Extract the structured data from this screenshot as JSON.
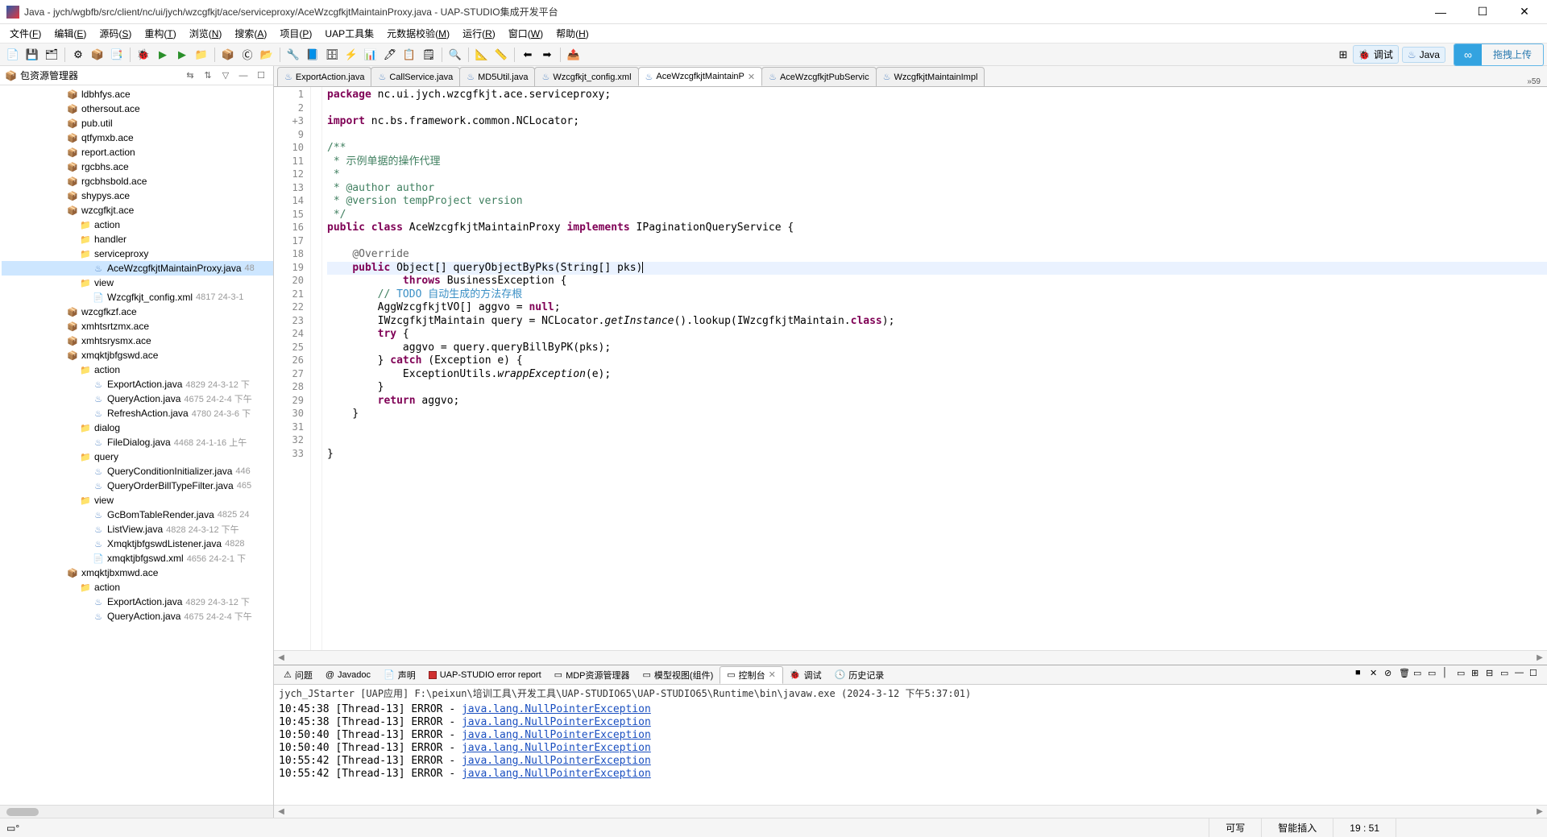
{
  "window": {
    "title": "Java - jych/wgbfb/src/client/nc/ui/jych/wzcgfkjt/ace/serviceproxy/AceWzcgfkjtMaintainProxy.java - UAP-STUDIO集成开发平台"
  },
  "menu": {
    "items": [
      {
        "label": "文件",
        "mn": "F"
      },
      {
        "label": "编辑",
        "mn": "E"
      },
      {
        "label": "源码",
        "mn": "S"
      },
      {
        "label": "重构",
        "mn": "T"
      },
      {
        "label": "浏览",
        "mn": "N"
      },
      {
        "label": "搜索",
        "mn": "A"
      },
      {
        "label": "项目",
        "mn": "P"
      },
      {
        "label": "UAP工具集",
        "mn": ""
      },
      {
        "label": "元数据校验",
        "mn": "M"
      },
      {
        "label": "运行",
        "mn": "R"
      },
      {
        "label": "窗口",
        "mn": "W"
      },
      {
        "label": "帮助",
        "mn": "H"
      }
    ]
  },
  "perspective": {
    "debug": "调试",
    "java": "Java"
  },
  "swap_upload": "拖拽上传",
  "package_explorer": {
    "title": "包资源管理器",
    "items": [
      {
        "type": "pkg",
        "depth": 0,
        "label": "ldbhfys.ace"
      },
      {
        "type": "pkg",
        "depth": 0,
        "label": "othersout.ace"
      },
      {
        "type": "pkg",
        "depth": 0,
        "label": "pub.util"
      },
      {
        "type": "pkg",
        "depth": 0,
        "label": "qtfymxb.ace"
      },
      {
        "type": "pkg",
        "depth": 0,
        "label": "report.action"
      },
      {
        "type": "pkg",
        "depth": 0,
        "label": "rgcbhs.ace"
      },
      {
        "type": "pkg",
        "depth": 0,
        "label": "rgcbhsbold.ace"
      },
      {
        "type": "pkg",
        "depth": 0,
        "label": "shypys.ace"
      },
      {
        "type": "pkg",
        "depth": 0,
        "label": "wzcgfkjt.ace"
      },
      {
        "type": "folder",
        "depth": 1,
        "label": "action"
      },
      {
        "type": "folder",
        "depth": 1,
        "label": "handler"
      },
      {
        "type": "folder",
        "depth": 1,
        "label": "serviceproxy"
      },
      {
        "type": "java",
        "depth": 2,
        "label": "AceWzcgfkjtMaintainProxy.java",
        "meta": "48",
        "selected": true
      },
      {
        "type": "folder",
        "depth": 1,
        "label": "view"
      },
      {
        "type": "xml",
        "depth": 2,
        "label": "Wzcgfkjt_config.xml",
        "meta": "4817  24-3-1"
      },
      {
        "type": "pkg",
        "depth": 0,
        "label": "wzcgfkzf.ace"
      },
      {
        "type": "pkg",
        "depth": 0,
        "label": "xmhtsrtzmx.ace"
      },
      {
        "type": "pkg",
        "depth": 0,
        "label": "xmhtsrysmx.ace"
      },
      {
        "type": "pkg",
        "depth": 0,
        "label": "xmqktjbfgswd.ace"
      },
      {
        "type": "folder",
        "depth": 1,
        "label": "action"
      },
      {
        "type": "java",
        "depth": 2,
        "label": "ExportAction.java",
        "meta": "4829  24-3-12 下"
      },
      {
        "type": "java",
        "depth": 2,
        "label": "QueryAction.java",
        "meta": "4675  24-2-4 下午"
      },
      {
        "type": "java",
        "depth": 2,
        "label": "RefreshAction.java",
        "meta": "4780  24-3-6 下"
      },
      {
        "type": "folder",
        "depth": 1,
        "label": "dialog"
      },
      {
        "type": "java",
        "depth": 2,
        "label": "FileDialog.java",
        "meta": "4468  24-1-16 上午"
      },
      {
        "type": "folder",
        "depth": 1,
        "label": "query"
      },
      {
        "type": "java",
        "depth": 2,
        "label": "QueryConditionInitializer.java",
        "meta": "446"
      },
      {
        "type": "java",
        "depth": 2,
        "label": "QueryOrderBillTypeFilter.java",
        "meta": "465"
      },
      {
        "type": "folder",
        "depth": 1,
        "label": "view"
      },
      {
        "type": "java",
        "depth": 2,
        "label": "GcBomTableRender.java",
        "meta": "4825  24"
      },
      {
        "type": "java",
        "depth": 2,
        "label": "ListView.java",
        "meta": "4828  24-3-12 下午"
      },
      {
        "type": "java",
        "depth": 2,
        "label": "XmqktjbfgswdListener.java",
        "meta": "4828"
      },
      {
        "type": "xml",
        "depth": 2,
        "label": "xmqktjbfgswd.xml",
        "meta": "4656  24-2-1 下"
      },
      {
        "type": "pkg",
        "depth": 0,
        "label": "xmqktjbxmwd.ace"
      },
      {
        "type": "folder",
        "depth": 1,
        "label": "action"
      },
      {
        "type": "java",
        "depth": 2,
        "label": "ExportAction.java",
        "meta": "4829  24-3-12 下"
      },
      {
        "type": "java",
        "depth": 2,
        "label": "QueryAction.java",
        "meta": "4675  24-2-4 下午"
      }
    ]
  },
  "editor_tabs": {
    "items": [
      {
        "label": "ExportAction.java"
      },
      {
        "label": "CallService.java"
      },
      {
        "label": "MD5Util.java"
      },
      {
        "label": "Wzcgfkjt_config.xml"
      },
      {
        "label": "AceWzcgfkjtMaintainP",
        "active": true,
        "close": true
      },
      {
        "label": "AceWzcgfkjtPubServic"
      },
      {
        "label": "WzcgfkjtMaintainImpl"
      }
    ],
    "overflow": "»59"
  },
  "code_lines": [
    {
      "n": 1,
      "t": "package",
      "rest": " nc.ui.jych.wzcgfkjt.ace.serviceproxy;"
    },
    {
      "n": 2,
      "blank": true
    },
    {
      "n": 3,
      "marker": "+",
      "t": "import",
      "rest": " nc.bs.framework.common.NCLocator;",
      "fold": "▢"
    },
    {
      "n": 9,
      "blank": true
    },
    {
      "n": 10,
      "cm": "/**",
      "fold": "⊟"
    },
    {
      "n": 11,
      "cm": " * 示例单据的操作代理"
    },
    {
      "n": 12,
      "cm": " * "
    },
    {
      "n": 13,
      "cm": " * @author author"
    },
    {
      "n": 14,
      "cm": " * @version tempProject version"
    },
    {
      "n": 15,
      "cm": " */"
    },
    {
      "n": 16,
      "raw": "<span class='kw'>public</span> <span class='kw'>class</span> AceWzcgfkjtMaintainProxy <span class='kw'>implements</span> IPaginationQueryService {"
    },
    {
      "n": 17,
      "blank": true
    },
    {
      "n": 18,
      "raw": "    <span class='an'>@Override</span>",
      "fold": "⊟"
    },
    {
      "n": 19,
      "hl": true,
      "raw": "    <span class='kw'>public</span> Object[] queryObjectByPks(String[] pks)<span class='caret'></span>"
    },
    {
      "n": 20,
      "raw": "            <span class='kw'>throws</span> BusinessException {"
    },
    {
      "n": 21,
      "raw": "        <span class='cm'>// </span><span class='todo'>TODO 自动生成的方法存根</span>"
    },
    {
      "n": 22,
      "raw": "        AggWzcgfkjtVO[] aggvo = <span class='kw'>null</span>;"
    },
    {
      "n": 23,
      "raw": "        IWzcgfkjtMaintain query = NCLocator.<i>getInstance</i>().lookup(IWzcgfkjtMaintain.<span class='kw'>class</span>);"
    },
    {
      "n": 24,
      "raw": "        <span class='kw'>try</span> {"
    },
    {
      "n": 25,
      "raw": "            aggvo = query.queryBillByPK(pks);"
    },
    {
      "n": 26,
      "raw": "        } <span class='kw'>catch</span> (Exception e) {"
    },
    {
      "n": 27,
      "raw": "            ExceptionUtils.<i>wrappException</i>(e);"
    },
    {
      "n": 28,
      "raw": "        }"
    },
    {
      "n": 29,
      "raw": "        <span class='kw'>return</span> aggvo;"
    },
    {
      "n": 30,
      "raw": "    }"
    },
    {
      "n": 31,
      "blank": true
    },
    {
      "n": 32,
      "blank": true
    },
    {
      "n": 33,
      "raw": "}"
    }
  ],
  "bottom_tabs": {
    "items": [
      {
        "label": "问题",
        "icon": "⚠"
      },
      {
        "label": "Javadoc",
        "icon": "@"
      },
      {
        "label": "声明",
        "icon": "📄"
      },
      {
        "label": "UAP-STUDIO error report",
        "icon": "■",
        "red": true
      },
      {
        "label": "MDP资源管理器",
        "icon": "▭"
      },
      {
        "label": "模型视图(组件)",
        "icon": "▭"
      },
      {
        "label": "控制台",
        "icon": "▭",
        "active": true,
        "close": true
      },
      {
        "label": "调试",
        "icon": "🐞"
      },
      {
        "label": "历史记录",
        "icon": "🕓"
      }
    ]
  },
  "console": {
    "head": "jych_JStarter [UAP应用] F:\\peixun\\培训工具\\开发工具\\UAP-STUDIO65\\UAP-STUDIO65\\Runtime\\bin\\javaw.exe (2024-3-12 下午5:37:01)",
    "rows": [
      {
        "prefix": "10:45:38 [Thread-13] ERROR - ",
        "link": "java.lang.NullPointerException"
      },
      {
        "prefix": "10:45:38 [Thread-13] ERROR - ",
        "link": "java.lang.NullPointerException"
      },
      {
        "prefix": "10:50:40 [Thread-13] ERROR - ",
        "link": "java.lang.NullPointerException"
      },
      {
        "prefix": "10:50:40 [Thread-13] ERROR - ",
        "link": "java.lang.NullPointerException"
      },
      {
        "prefix": "10:55:42 [Thread-13] ERROR - ",
        "link": "java.lang.NullPointerException"
      },
      {
        "prefix": "10:55:42 [Thread-13] ERROR - ",
        "link": "java.lang.NullPointerException"
      }
    ]
  },
  "status": {
    "writable": "可写",
    "insert": "智能插入",
    "pos": "19 :  51"
  }
}
